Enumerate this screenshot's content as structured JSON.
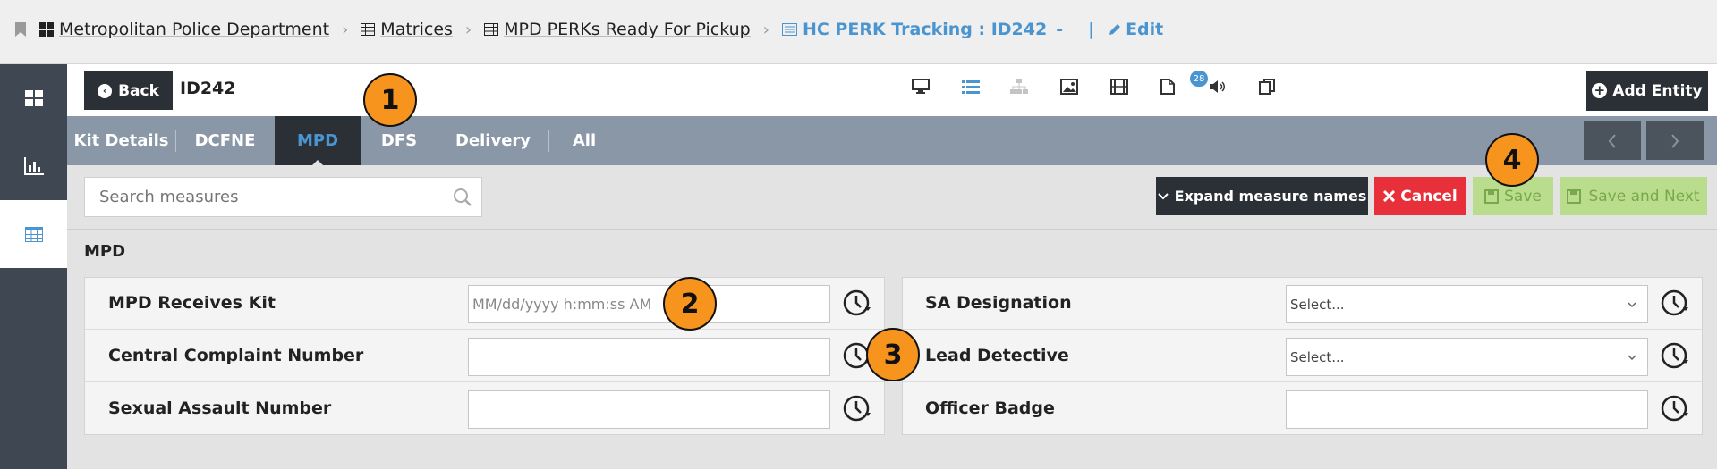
{
  "breadcrumb": {
    "items": [
      "Metropolitan Police Department",
      "Matrices",
      "MPD PERKs Ready For Pickup"
    ],
    "current": "HC PERK Tracking : ID242",
    "current_suffix": "-",
    "edit_bar": "|",
    "edit_label": "Edit"
  },
  "header": {
    "back_label": "Back",
    "entity_id": "ID242",
    "list_badge": "28",
    "add_entity_label": "Add Entity"
  },
  "tabs": [
    {
      "label": "Kit Details"
    },
    {
      "label": "DCFNE"
    },
    {
      "label": "MPD"
    },
    {
      "label": "DFS"
    },
    {
      "label": "Delivery"
    },
    {
      "label": "All"
    }
  ],
  "toolbar": {
    "search_placeholder": "Search measures",
    "expand_label": "Expand measure names",
    "cancel_label": "Cancel",
    "save_label": "Save",
    "save_next_label": "Save and Next"
  },
  "section": {
    "title": "MPD",
    "left_fields": [
      {
        "label": "MPD Receives Kit",
        "placeholder": "MM/dd/yyyy h:mm:ss AM",
        "value": ""
      },
      {
        "label": "Central Complaint Number",
        "placeholder": "",
        "value": ""
      },
      {
        "label": "Sexual Assault Number",
        "placeholder": "",
        "value": ""
      }
    ],
    "right_fields": [
      {
        "label": "SA Designation",
        "value": "Select..."
      },
      {
        "label": "Lead Detective",
        "value": "Select..."
      },
      {
        "label": "Officer Badge",
        "value": ""
      }
    ]
  },
  "markers": [
    "1",
    "2",
    "3",
    "4"
  ],
  "colors": {
    "accent": "#4a95cf",
    "dark": "#2b2f36",
    "tabbar": "#8a97a6",
    "cancel": "#e8303b",
    "save": "#b9dd8c",
    "marker": "#f7941d"
  }
}
